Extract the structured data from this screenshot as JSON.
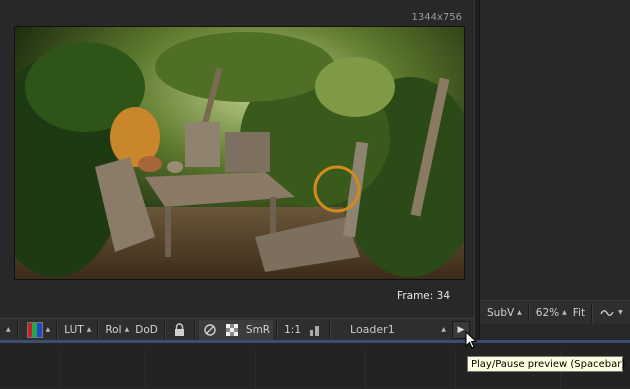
{
  "viewer": {
    "resolution": "1344x756",
    "frame_label": "Frame: 34"
  },
  "toolbar": {
    "lut_label": "LUT",
    "roi_label": "RoI",
    "dod_label": "DoD",
    "smr_label": "SmR",
    "one_to_one_label": "1:1",
    "loader_name": "Loader1"
  },
  "right_toolbar": {
    "subv_label": "SubV",
    "zoom_value": "62%",
    "fit_label": "Fit"
  },
  "tooltip": {
    "text": "Play/Pause preview (Spacebar)"
  },
  "colors": {
    "background": "#282828",
    "toolbar": "#2e2e2e",
    "timeline_accent": "#3b4e6f",
    "tooltip_bg": "#ffffe1"
  },
  "icons": [
    "lock-icon",
    "channel-swatch-icon",
    "stereo-icon",
    "checker-icon",
    "levels-icon",
    "play-icon",
    "wave-icon",
    "dropdown-triangle-icon"
  ]
}
